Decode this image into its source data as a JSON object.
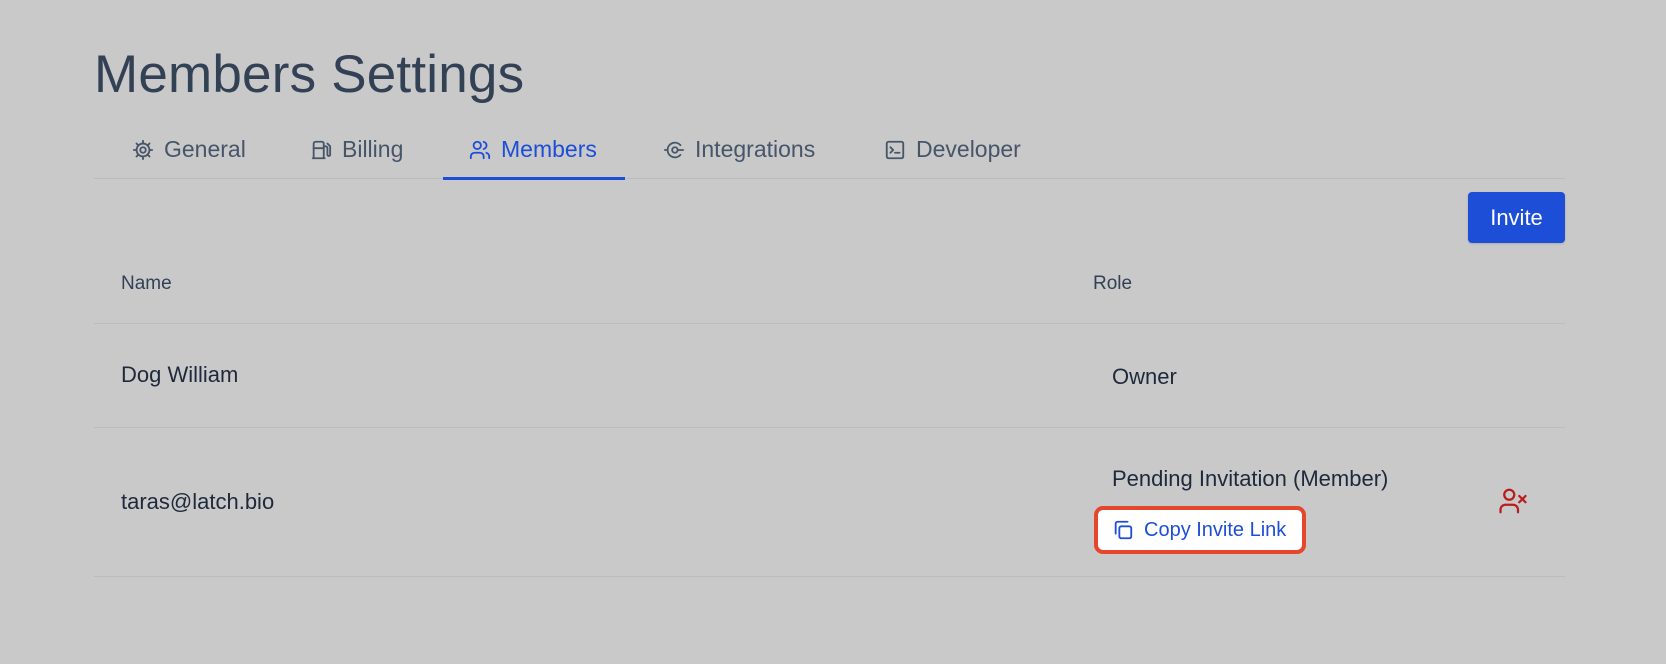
{
  "page": {
    "title": "Members Settings"
  },
  "tabs": [
    {
      "label": "General",
      "icon": "gear-icon",
      "active": false
    },
    {
      "label": "Billing",
      "icon": "fuel-pump-icon",
      "active": false
    },
    {
      "label": "Members",
      "icon": "users-icon",
      "active": true
    },
    {
      "label": "Integrations",
      "icon": "integration-icon",
      "active": false
    },
    {
      "label": "Developer",
      "icon": "terminal-icon",
      "active": false
    }
  ],
  "actions": {
    "invite_label": "Invite"
  },
  "table": {
    "headers": {
      "name": "Name",
      "role": "Role"
    },
    "rows": [
      {
        "name": "Dog William",
        "role": "Owner"
      },
      {
        "name": "taras@latch.bio",
        "role": "Pending Invitation (Member)",
        "copy_link_label": "Copy Invite Link",
        "remove_icon": "user-remove-icon"
      }
    ]
  },
  "colors": {
    "accent": "#1d4ed8",
    "background": "#c9c9c9",
    "highlight": "#e5472d",
    "danger": "#b91c1c"
  }
}
